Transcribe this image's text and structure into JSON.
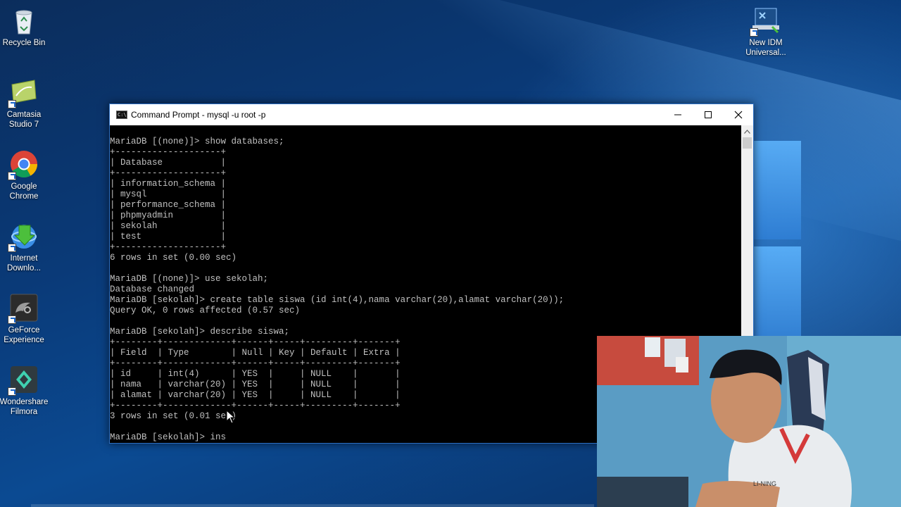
{
  "desktop": {
    "icons": [
      {
        "label": "Recycle Bin",
        "icon": "recycle-bin-icon"
      },
      {
        "label": "Camtasia Studio 7",
        "icon": "camtasia-icon"
      },
      {
        "label": "Google Chrome",
        "icon": "chrome-icon"
      },
      {
        "label": "Internet Downlo...",
        "icon": "idm-icon"
      },
      {
        "label": "GeForce Experience",
        "icon": "geforce-icon"
      },
      {
        "label": "Wondershare Filmora",
        "icon": "filmora-icon"
      },
      {
        "label": "New IDM Universal...",
        "icon": "idm-universal-icon"
      }
    ]
  },
  "window": {
    "title": "Command Prompt - mysql  -u root -p",
    "icon_text": "C:\\",
    "controls": [
      "minimize",
      "maximize",
      "close"
    ]
  },
  "terminal": {
    "lines": [
      "MariaDB [(none)]> show databases;",
      "+--------------------+",
      "| Database           |",
      "+--------------------+",
      "| information_schema |",
      "| mysql              |",
      "| performance_schema |",
      "| phpmyadmin         |",
      "| sekolah            |",
      "| test               |",
      "+--------------------+",
      "6 rows in set (0.00 sec)",
      "",
      "MariaDB [(none)]> use sekolah;",
      "Database changed",
      "MariaDB [sekolah]> create table siswa (id int(4),nama varchar(20),alamat varchar(20));",
      "Query OK, 0 rows affected (0.57 sec)",
      "",
      "MariaDB [sekolah]> describe siswa;",
      "+--------+-------------+------+-----+---------+-------+",
      "| Field  | Type        | Null | Key | Default | Extra |",
      "+--------+-------------+------+-----+---------+-------+",
      "| id     | int(4)      | YES  |     | NULL    |       |",
      "| nama   | varchar(20) | YES  |     | NULL    |       |",
      "| alamat | varchar(20) | YES  |     | NULL    |       |",
      "+--------+-------------+------+-----+---------+-------+",
      "3 rows in set (0.01 sec)",
      "",
      "MariaDB [sekolah]> ins"
    ]
  },
  "webcam": {
    "shirt_text": "LI-NING"
  }
}
